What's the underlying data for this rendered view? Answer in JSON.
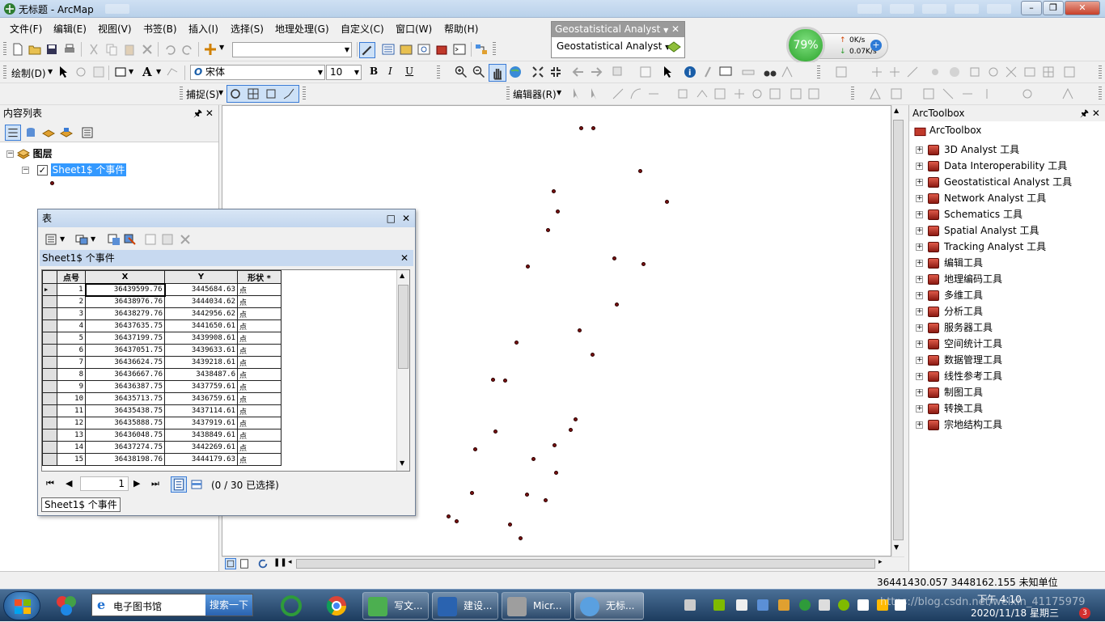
{
  "window": {
    "title": "无标题 - ArcMap"
  },
  "menu": [
    "文件(F)",
    "编辑(E)",
    "视图(V)",
    "书签(B)",
    "插入(I)",
    "选择(S)",
    "地理处理(G)",
    "自定义(C)",
    "窗口(W)",
    "帮助(H)"
  ],
  "toolbar": {
    "draw_label": "绘制(D)",
    "font_name": "宋体",
    "font_size": "10",
    "snap_label": "捕捉(S)",
    "editor_label": "编辑器(R)"
  },
  "geostat": {
    "title": "Geostatistical Analyst",
    "menu_label": "Geostatistical Analyst"
  },
  "network": {
    "percent": "79%",
    "up": "0K/s",
    "down": "0.07K/s"
  },
  "toc": {
    "title": "内容列表",
    "layers_label": "图层",
    "layer_name": "Sheet1$ 个事件"
  },
  "table_window": {
    "title": "表",
    "sheet_title": "Sheet1$ 个事件",
    "tab_label": "Sheet1$ 个事件",
    "page": "1",
    "selection": "(0 / 30 已选择)",
    "columns": [
      "点号",
      "X",
      "Y",
      "形状 *"
    ],
    "rows": [
      [
        "1",
        "36439599.76",
        "3445684.63",
        "点"
      ],
      [
        "2",
        "36438976.76",
        "3444034.62",
        "点"
      ],
      [
        "3",
        "36438279.76",
        "3442956.62",
        "点"
      ],
      [
        "4",
        "36437635.75",
        "3441650.61",
        "点"
      ],
      [
        "5",
        "36437199.75",
        "3439908.61",
        "点"
      ],
      [
        "6",
        "36437051.75",
        "3439633.61",
        "点"
      ],
      [
        "7",
        "36436624.75",
        "3439218.61",
        "点"
      ],
      [
        "8",
        "36436667.76",
        "3438487.6",
        "点"
      ],
      [
        "9",
        "36436387.75",
        "3437759.61",
        "点"
      ],
      [
        "10",
        "36435713.75",
        "3436759.61",
        "点"
      ],
      [
        "11",
        "36435438.75",
        "3437114.61",
        "点"
      ],
      [
        "12",
        "36435888.75",
        "3437919.61",
        "点"
      ],
      [
        "13",
        "36436048.75",
        "3438849.61",
        "点"
      ],
      [
        "14",
        "36437274.75",
        "3442269.61",
        "点"
      ],
      [
        "15",
        "36438198.76",
        "3444179.63",
        "点"
      ]
    ]
  },
  "toolbox": {
    "title": "ArcToolbox",
    "root": "ArcToolbox",
    "items": [
      "3D Analyst 工具",
      "Data Interoperability 工具",
      "Geostatistical Analyst 工具",
      "Network Analyst 工具",
      "Schematics 工具",
      "Spatial Analyst 工具",
      "Tracking Analyst 工具",
      "编辑工具",
      "地理编码工具",
      "多维工具",
      "分析工具",
      "服务器工具",
      "空间统计工具",
      "数据管理工具",
      "线性参考工具",
      "制图工具",
      "转换工具",
      "宗地结构工具"
    ]
  },
  "status": {
    "coords": "36441430.057  3448162.155 未知单位"
  },
  "taskbar": {
    "search_text": "电子图书馆",
    "search_button": "搜索一下",
    "apps": [
      "写文...",
      "建设...",
      "Micr...",
      "无标..."
    ],
    "time": "下午 4:10",
    "date": "2020/11/18 星期三",
    "watermark": "https://blog.csdn.net/weixin_41175979"
  },
  "colors": {
    "selection": "#3399ff",
    "point": "#7a1010",
    "taskbar": "#1c3b5e"
  }
}
